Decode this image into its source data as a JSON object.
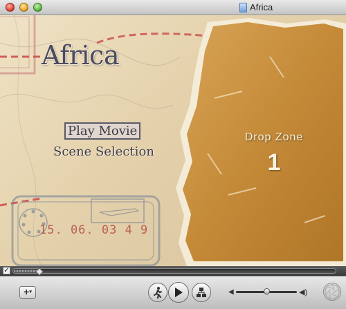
{
  "window": {
    "title": "Africa"
  },
  "menu": {
    "title": "Africa",
    "play_movie": "Play Movie",
    "scene_selection": "Scene Selection"
  },
  "stamp": {
    "date": "15. 06. 03 4 9"
  },
  "drop_zone": {
    "label": "Drop Zone",
    "number": "1"
  },
  "scrubber": {
    "checked": true,
    "progress": 0.08
  },
  "volume": {
    "level": 0.5
  },
  "icons": {
    "add": "add-menu-icon",
    "scene": "walking-person-icon",
    "play": "play-icon",
    "chapters": "chapter-tree-icon",
    "volume_low": "speaker-low-icon",
    "volume_high": "speaker-high-icon",
    "aperture": "aperture-icon"
  },
  "colors": {
    "paper": "#c88f3c",
    "title_text": "#4a4a60",
    "stamp_red": "#b23c3c"
  }
}
